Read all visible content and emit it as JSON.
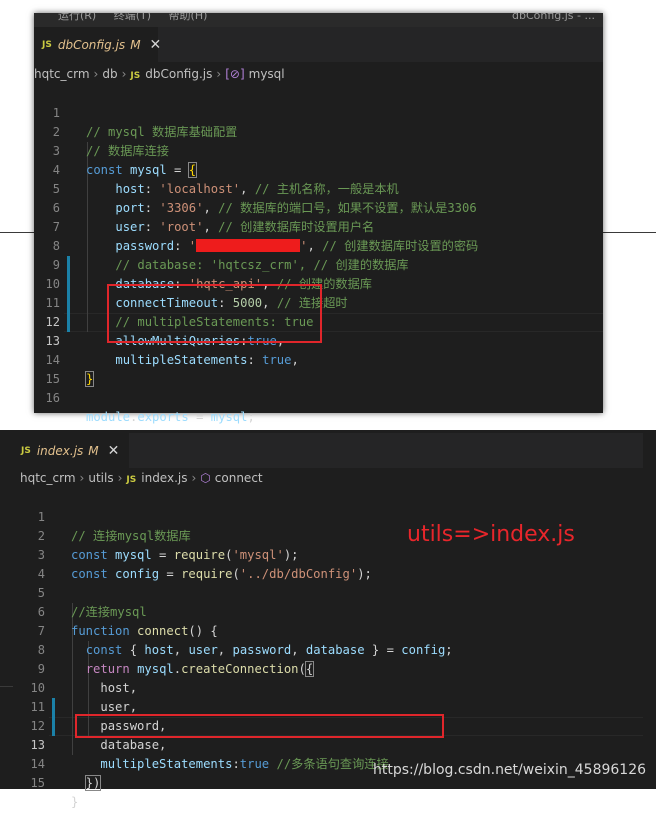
{
  "top_panel": {
    "menu_items": [
      "运行(R)",
      "终端(T)",
      "帮助(H)"
    ],
    "window_title": "dbConfig.js - ...",
    "tab": {
      "icon": "JS",
      "filename": "dbConfig.js",
      "modified": "M"
    },
    "breadcrumb": [
      "hqtc_crm",
      "db",
      "dbConfig.js",
      "mysql"
    ],
    "lines": [
      "1",
      "2",
      "3",
      "4",
      "5",
      "6",
      "7",
      "8",
      "9",
      "10",
      "11",
      "12",
      "13",
      "14",
      "15",
      "16"
    ],
    "code": {
      "l1_comment": "// mysql 数据库基础配置",
      "l2_comment": "// 数据库连接",
      "l3_const": "const",
      "l3_name": "mysql",
      "l3_eq": " = ",
      "l3_brace": "{",
      "l4_key": "host",
      "l4_val": "'localhost'",
      "l4_comment": "// 主机名称，一般是本机",
      "l5_key": "port",
      "l5_val": "'3306'",
      "l5_comment": "// 数据库的端口号，如果不设置，默认是3306",
      "l6_key": "user",
      "l6_val": "'root'",
      "l6_comment": "// 创建数据库时设置用户名",
      "l7_key": "password",
      "l7_comment": "// 创建数据库时设置的密码",
      "l8_comment": "// database: 'hqtcsz_crm', // 创建的数据库",
      "l9_key": "database",
      "l9_val": "'hqtc_api'",
      "l9_comment": "// 创建的数据库",
      "l10_key": "connectTimeout",
      "l10_val": "5000",
      "l10_comment": "// 连接超时",
      "l11_comment": "// multipleStatements: true",
      "l12_key": "allowMultiQueries",
      "l12_val": "true",
      "l13_key": "multipleStatements",
      "l13_val": "true",
      "l14_brace": "}",
      "l16_module": "module",
      "l16_exports": "exports",
      "l16_rest": "mysql"
    }
  },
  "bottom_panel": {
    "tab": {
      "icon": "JS",
      "filename": "index.js",
      "modified": "M"
    },
    "breadcrumb": [
      "hqtc_crm",
      "utils",
      "index.js",
      "connect"
    ],
    "lines": [
      "1",
      "2",
      "3",
      "4",
      "5",
      "6",
      "7",
      "8",
      "9",
      "10",
      "11",
      "12",
      "13",
      "14",
      "15"
    ],
    "code": {
      "l1_comment": "// 连接mysql数据库",
      "l2_const": "const",
      "l2_name": "mysql",
      "l2_req": "require",
      "l2_arg": "'mysql'",
      "l3_const": "const",
      "l3_name": "config",
      "l3_req": "require",
      "l3_arg": "'../db/dbConfig'",
      "l5_comment": "//连接mysql",
      "l6_function": "function",
      "l6_name": "connect",
      "l7_const": "const",
      "l7_vars": [
        "host",
        "user",
        "password",
        "database"
      ],
      "l7_config": "config",
      "l8_return": "return",
      "l8_obj": "mysql",
      "l8_method": "createConnection",
      "l9": "host,",
      "l10": "user,",
      "l11": "password,",
      "l12": "database,",
      "l13_key": "multipleStatements",
      "l13_val": "true",
      "l13_comment": "//多条语句查询连接",
      "l14": "})",
      "l15": "}"
    },
    "annotation": "utils=>index.js",
    "watermark": "https://blog.csdn.net/weixin_45896126"
  },
  "colors": {
    "editor_bg": "#1e1e1e",
    "keyword": "#569cd6",
    "comment": "#6a9955",
    "string": "#ce9178",
    "variable": "#9cdcfe",
    "annotation_red": "#e8262b"
  }
}
